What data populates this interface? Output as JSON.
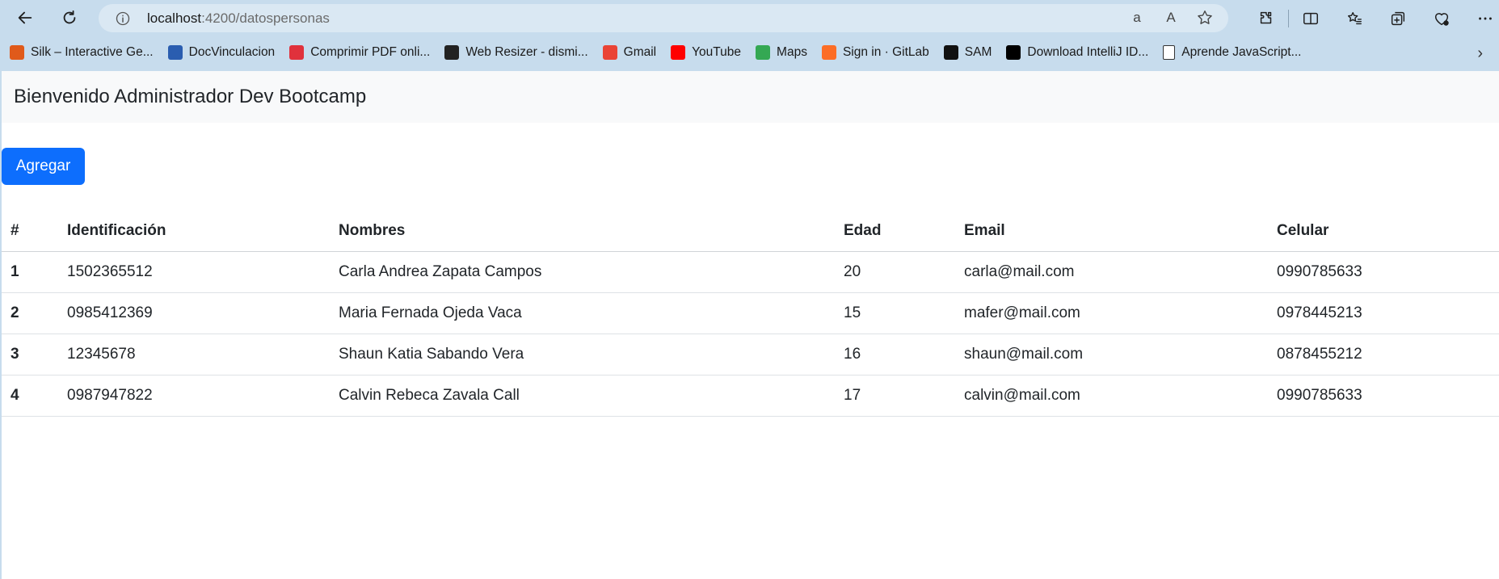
{
  "browser": {
    "url_host": "localhost",
    "url_path": ":4200/datospersonas",
    "read_aloud_label": "A",
    "translate_label": "a"
  },
  "bookmarks": [
    {
      "label": "Silk – Interactive Ge...",
      "icon": "silk-icon",
      "color": "#e05a1a"
    },
    {
      "label": "DocVinculacion",
      "icon": "ug-icon",
      "color": "#2a5db0"
    },
    {
      "label": "Comprimir PDF onli...",
      "icon": "heart-icon",
      "color": "#e0313c"
    },
    {
      "label": "Web Resizer - dismi...",
      "icon": "web-resizer-icon",
      "color": "#222222"
    },
    {
      "label": "Gmail",
      "icon": "gmail-icon",
      "color": "#ea4335"
    },
    {
      "label": "YouTube",
      "icon": "youtube-icon",
      "color": "#ff0000"
    },
    {
      "label": "Maps",
      "icon": "maps-icon",
      "color": "#34a853"
    },
    {
      "label": "Sign in · GitLab",
      "icon": "gitlab-icon",
      "color": "#fc6d26"
    },
    {
      "label": "SAM",
      "icon": "home-icon",
      "color": "#111111"
    },
    {
      "label": "Download IntelliJ ID...",
      "icon": "intellij-icon",
      "color": "#000000"
    },
    {
      "label": "Aprende JavaScript...",
      "icon": "page-icon",
      "color": "#ffffff"
    }
  ],
  "navbar": {
    "title": "Bienvenido Administrador Dev Bootcamp"
  },
  "actions": {
    "add_label": "Agregar"
  },
  "table": {
    "headers": [
      "#",
      "Identificación",
      "Nombres",
      "Edad",
      "Email",
      "Celular"
    ],
    "rows": [
      [
        "1",
        "1502365512",
        "Carla Andrea Zapata Campos",
        "20",
        "carla@mail.com",
        "0990785633"
      ],
      [
        "2",
        "0985412369",
        "Maria Fernada Ojeda Vaca",
        "15",
        "mafer@mail.com",
        "0978445213"
      ],
      [
        "3",
        "12345678",
        "Shaun Katia Sabando Vera",
        "16",
        "shaun@mail.com",
        "0878455212"
      ],
      [
        "4",
        "0987947822",
        "Calvin Rebeca Zavala Call",
        "17",
        "calvin@mail.com",
        "0990785633"
      ]
    ]
  },
  "colors": {
    "primary": "#0d6efd",
    "navbar_bg": "#f8f9fa",
    "browser_chrome": "#c7dced"
  }
}
